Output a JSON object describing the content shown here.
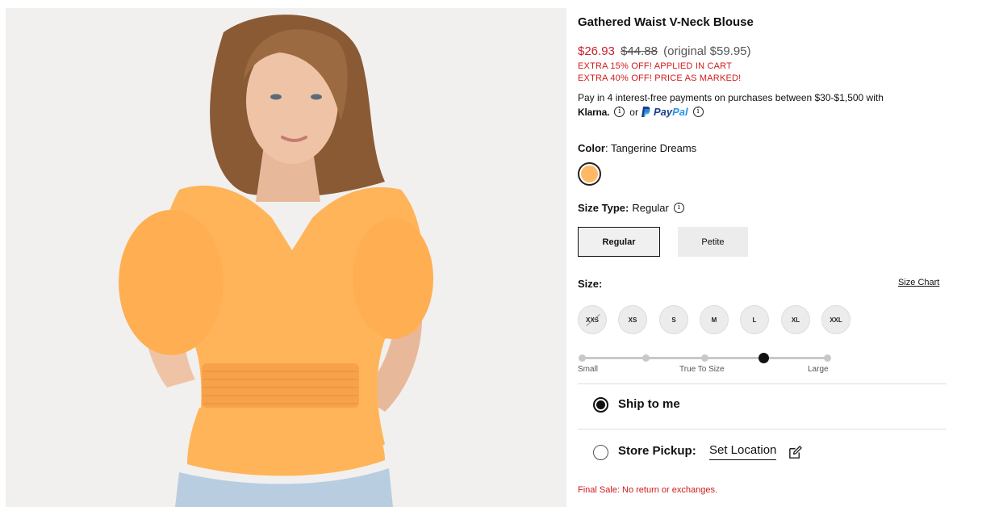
{
  "product": {
    "title": "Gathered Waist V-Neck Blouse",
    "price_sale": "$26.93",
    "price_was": "$44.88",
    "price_original": "(original $59.95)",
    "promo_1": "EXTRA 15% OFF! APPLIED IN CART",
    "promo_2": "EXTRA 40% OFF! PRICE AS MARKED!",
    "final_sale": "Final Sale: No return or exchanges."
  },
  "payment": {
    "installments_text": "Pay in 4 interest-free payments on purchases between $30-$1,500 with",
    "klarna": "Klarna.",
    "or": "or",
    "paypal_a": "Pay",
    "paypal_b": "Pal"
  },
  "color": {
    "label": "Color",
    "value": ": Tangerine Dreams",
    "swatch_hex": "#ffb866"
  },
  "size_type": {
    "label": "Size Type:",
    "value": "Regular",
    "options": [
      "Regular",
      "Petite"
    ],
    "selected": "Regular"
  },
  "size": {
    "label": "Size:",
    "chart_link": "Size Chart",
    "options": [
      "XXS",
      "XS",
      "S",
      "M",
      "L",
      "XL",
      "XXL"
    ],
    "unavailable": [
      "XXS"
    ]
  },
  "fit": {
    "labels": [
      "Small",
      "True To Size",
      "Large"
    ],
    "stops": 5,
    "selected_stop": 4
  },
  "fulfillment": {
    "ship": "Ship to me",
    "pickup": "Store Pickup:",
    "set_location": "Set Location",
    "selected": "ship"
  },
  "colors": {
    "sale_red": "#c8202a",
    "promo_red": "#d11a1a",
    "paypal_dark": "#1d3e8f",
    "paypal_light": "#2797e0"
  }
}
